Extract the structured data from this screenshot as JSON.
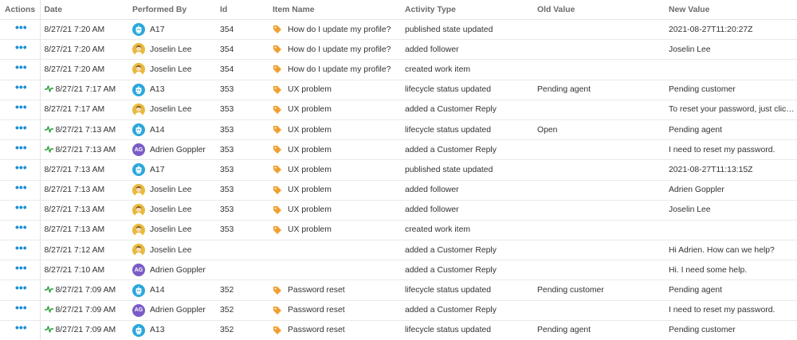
{
  "columns": {
    "actions": "Actions",
    "date": "Date",
    "performed_by": "Performed By",
    "id": "Id",
    "item_name": "Item Name",
    "activity_type": "Activity Type",
    "old_value": "Old Value",
    "new_value": "New Value"
  },
  "actions_glyph": "•••",
  "icons": {
    "actions": "more-horizontal-icon",
    "activity": "activity-pulse-icon",
    "item": "tag-icon",
    "bot_avatar": "bot-avatar-icon",
    "photo_avatar": "user-photo-avatar"
  },
  "colors": {
    "link_blue": "#1a8fd6",
    "pulse_green": "#2e9e3e",
    "tag_orange": "#f0a030",
    "bot_blue": "#2aa7dc",
    "initials_purple": "#7b5cc6",
    "photo_gold": "#e9b93a"
  },
  "rows": [
    {
      "pulse": false,
      "date": "8/27/21 7:20 AM",
      "avatar": "bot",
      "initials": "",
      "performer": "A17",
      "id": "354",
      "tag": true,
      "item": "How do I update my profile?",
      "activity": "published state updated",
      "old": "",
      "new": "2021-08-27T11:20:27Z"
    },
    {
      "pulse": false,
      "date": "8/27/21 7:20 AM",
      "avatar": "photo",
      "initials": "",
      "performer": "Joselin Lee",
      "id": "354",
      "tag": true,
      "item": "How do I update my profile?",
      "activity": "added follower",
      "old": "",
      "new": "Joselin Lee"
    },
    {
      "pulse": false,
      "date": "8/27/21 7:20 AM",
      "avatar": "photo",
      "initials": "",
      "performer": "Joselin Lee",
      "id": "354",
      "tag": true,
      "item": "How do I update my profile?",
      "activity": "created work item",
      "old": "",
      "new": ""
    },
    {
      "pulse": true,
      "date": "8/27/21 7:17 AM",
      "avatar": "bot",
      "initials": "",
      "performer": "A13",
      "id": "353",
      "tag": true,
      "item": "UX problem",
      "activity": "lifecycle status updated",
      "old": "Pending agent",
      "new": "Pending customer"
    },
    {
      "pulse": false,
      "date": "8/27/21 7:17 AM",
      "avatar": "photo",
      "initials": "",
      "performer": "Joselin Lee",
      "id": "353",
      "tag": true,
      "item": "UX problem",
      "activity": "added a Customer Reply",
      "old": "",
      "new": "To reset your password, just click Re..."
    },
    {
      "pulse": true,
      "date": "8/27/21 7:13 AM",
      "avatar": "bot",
      "initials": "",
      "performer": "A14",
      "id": "353",
      "tag": true,
      "item": "UX problem",
      "activity": "lifecycle status updated",
      "old": "Open",
      "new": "Pending agent"
    },
    {
      "pulse": true,
      "date": "8/27/21 7:13 AM",
      "avatar": "initials",
      "initials": "AG",
      "performer": "Adrien Goppler",
      "id": "353",
      "tag": true,
      "item": "UX problem",
      "activity": "added a Customer Reply",
      "old": "",
      "new": "I need to reset my password."
    },
    {
      "pulse": false,
      "date": "8/27/21 7:13 AM",
      "avatar": "bot",
      "initials": "",
      "performer": "A17",
      "id": "353",
      "tag": true,
      "item": "UX problem",
      "activity": "published state updated",
      "old": "",
      "new": "2021-08-27T11:13:15Z"
    },
    {
      "pulse": false,
      "date": "8/27/21 7:13 AM",
      "avatar": "photo",
      "initials": "",
      "performer": "Joselin Lee",
      "id": "353",
      "tag": true,
      "item": "UX problem",
      "activity": "added follower",
      "old": "",
      "new": "Adrien Goppler"
    },
    {
      "pulse": false,
      "date": "8/27/21 7:13 AM",
      "avatar": "photo",
      "initials": "",
      "performer": "Joselin Lee",
      "id": "353",
      "tag": true,
      "item": "UX problem",
      "activity": "added follower",
      "old": "",
      "new": "Joselin Lee"
    },
    {
      "pulse": false,
      "date": "8/27/21 7:13 AM",
      "avatar": "photo",
      "initials": "",
      "performer": "Joselin Lee",
      "id": "353",
      "tag": true,
      "item": "UX problem",
      "activity": "created work item",
      "old": "",
      "new": ""
    },
    {
      "pulse": false,
      "date": "8/27/21 7:12 AM",
      "avatar": "photo",
      "initials": "",
      "performer": "Joselin Lee",
      "id": "",
      "tag": false,
      "item": "",
      "activity": "added a Customer Reply",
      "old": "",
      "new": "Hi Adrien. How can we help?"
    },
    {
      "pulse": false,
      "date": "8/27/21 7:10 AM",
      "avatar": "initials",
      "initials": "AG",
      "performer": "Adrien Goppler",
      "id": "",
      "tag": false,
      "item": "",
      "activity": "added a Customer Reply",
      "old": "",
      "new": "Hi. I need some help."
    },
    {
      "pulse": true,
      "date": "8/27/21 7:09 AM",
      "avatar": "bot",
      "initials": "",
      "performer": "A14",
      "id": "352",
      "tag": true,
      "item": "Password reset",
      "activity": "lifecycle status updated",
      "old": "Pending customer",
      "new": "Pending agent"
    },
    {
      "pulse": true,
      "date": "8/27/21 7:09 AM",
      "avatar": "initials",
      "initials": "AG",
      "performer": "Adrien Goppler",
      "id": "352",
      "tag": true,
      "item": "Password reset",
      "activity": "added a Customer Reply",
      "old": "",
      "new": "I need to reset my password."
    },
    {
      "pulse": true,
      "date": "8/27/21 7:09 AM",
      "avatar": "bot",
      "initials": "",
      "performer": "A13",
      "id": "352",
      "tag": true,
      "item": "Password reset",
      "activity": "lifecycle status updated",
      "old": "Pending agent",
      "new": "Pending customer"
    }
  ]
}
